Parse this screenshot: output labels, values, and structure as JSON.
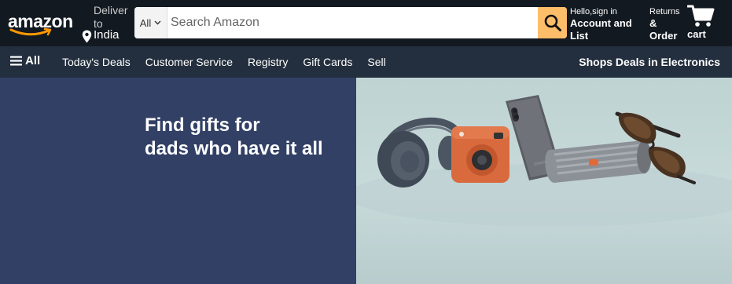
{
  "header": {
    "logo_text": "amazon",
    "deliver": {
      "line1": "Deliver",
      "line2": "to",
      "location": "India",
      "icon": "location-pin-icon"
    },
    "search": {
      "category": "All",
      "placeholder": "Search Amazon",
      "value": "",
      "button_icon": "search-icon"
    },
    "account": {
      "line1": "Hello,sign in",
      "line2": "Account and",
      "line3": "List"
    },
    "orders": {
      "line1": "Returns",
      "line2": "&",
      "line3": "Order"
    },
    "cart": {
      "label": "cart",
      "icon": "cart-icon"
    }
  },
  "nav": {
    "all_label": "All",
    "links": [
      "Today's Deals",
      "Customer Service",
      "Registry",
      "Gift Cards",
      "Sell"
    ],
    "promo": "Shops Deals in Electronics"
  },
  "hero": {
    "line1": "Find gifts for",
    "line2": "dads who have it all",
    "products": [
      "headphones",
      "instant-camera",
      "smartphone",
      "speaker",
      "sunglasses"
    ]
  },
  "colors": {
    "topbar": "#131921",
    "navbar": "#232f3e",
    "search_button": "#febd69",
    "hero_left": "#324066",
    "hero_right": "#c4d7d7",
    "logo_smile": "#ff9900"
  }
}
